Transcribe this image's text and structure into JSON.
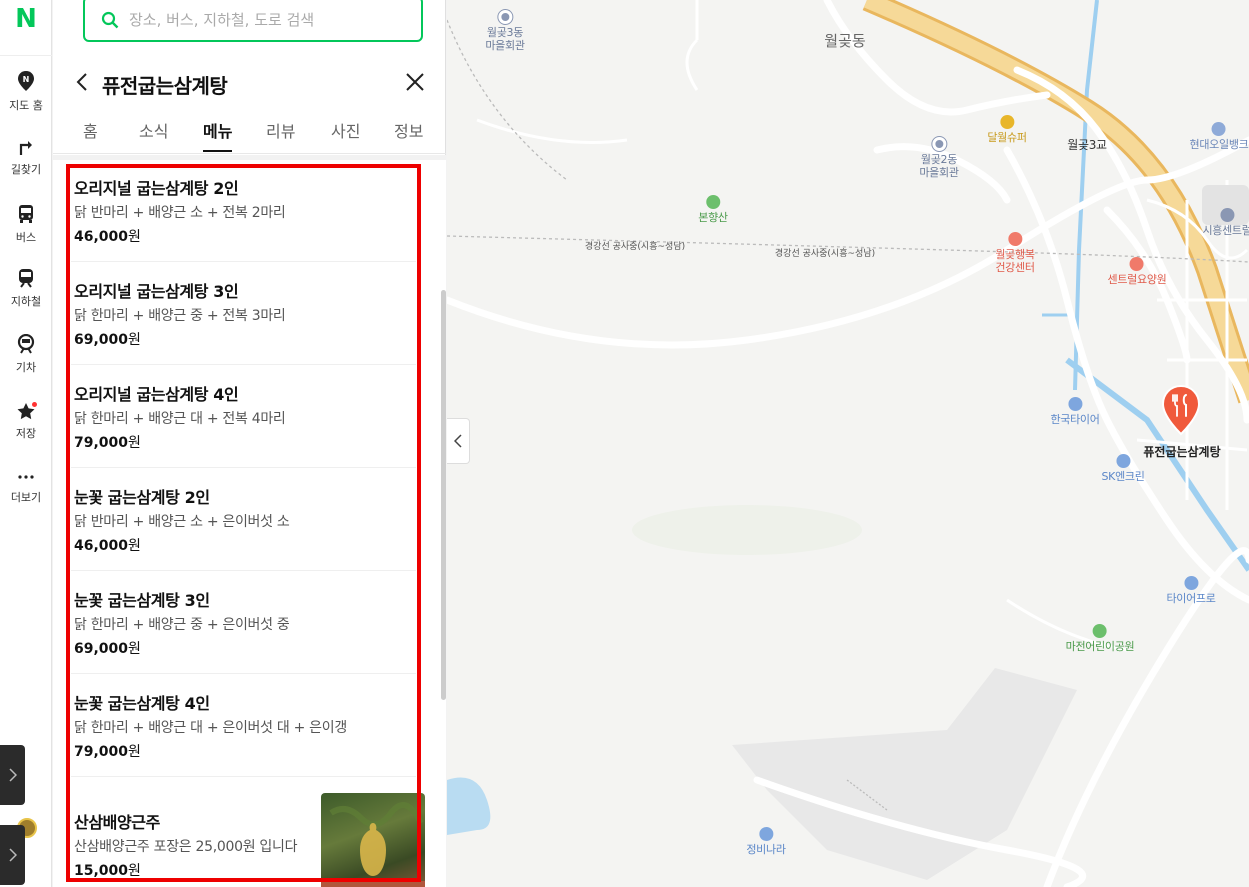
{
  "rail": {
    "logo": "N",
    "items": [
      {
        "label": "지도 홈",
        "icon": "map-home-icon"
      },
      {
        "label": "길찾기",
        "icon": "directions-icon"
      },
      {
        "label": "버스",
        "icon": "bus-icon"
      },
      {
        "label": "지하철",
        "icon": "subway-icon"
      },
      {
        "label": "기차",
        "icon": "train-icon"
      },
      {
        "label": "저장",
        "icon": "star-icon"
      },
      {
        "label": "더보기",
        "icon": "more-icon"
      }
    ]
  },
  "search": {
    "placeholder": "장소, 버스, 지하철, 도로 검색"
  },
  "place": {
    "title": "퓨전굽는삼계탕"
  },
  "tabs": [
    {
      "label": "홈",
      "active": false
    },
    {
      "label": "소식",
      "active": false
    },
    {
      "label": "메뉴",
      "active": true
    },
    {
      "label": "리뷰",
      "active": false
    },
    {
      "label": "사진",
      "active": false
    },
    {
      "label": "정보",
      "active": false
    }
  ],
  "menu": [
    {
      "name": "오리지널 굽는삼계탕 2인",
      "desc": "닭 반마리 + 배양근 소 + 전복 2마리",
      "price": "46,000",
      "unit": "원"
    },
    {
      "name": "오리지널 굽는삼계탕 3인",
      "desc": "닭 한마리 + 배양근 중 + 전복 3마리",
      "price": "69,000",
      "unit": "원"
    },
    {
      "name": "오리지널 굽는삼계탕 4인",
      "desc": "닭 한마리 + 배양근 대 + 전복 4마리",
      "price": "79,000",
      "unit": "원"
    },
    {
      "name": "눈꽃 굽는삼계탕 2인",
      "desc": "닭 반마리 + 배양근 소 + 은이버섯 소",
      "price": "46,000",
      "unit": "원"
    },
    {
      "name": "눈꽃 굽는삼계탕 3인",
      "desc": "닭 한마리 + 배양근 중 + 은이버섯 중",
      "price": "69,000",
      "unit": "원"
    },
    {
      "name": "눈꽃 굽는삼계탕 4인",
      "desc": "닭 한마리 + 배양근 대 + 은이버섯 대 + 은이갱",
      "price": "79,000",
      "unit": "원"
    },
    {
      "name": "산삼배양근주",
      "desc": "산삼배양근주 포장은 25,000원 입니다",
      "price": "15,000",
      "unit": "원"
    }
  ],
  "map": {
    "area_labels": [
      {
        "text": "월곶동"
      }
    ],
    "pois": [
      {
        "text": "월곶3동\n마을회관",
        "color": "#6a7a99"
      },
      {
        "text": "달월슈퍼",
        "color": "#c89a1c"
      },
      {
        "text": "월곶3교",
        "color": "#333333"
      },
      {
        "text": "현대오일뱅크",
        "color": "#6a86b8"
      },
      {
        "text": "월곶2동\n마을회관",
        "color": "#6a7a99"
      },
      {
        "text": "본향산",
        "color": "#4a9a4a"
      },
      {
        "text": "시흥센트럴",
        "color": "#6a7a99"
      },
      {
        "text": "월곶행복\n건강센터",
        "color": "#e05a4a"
      },
      {
        "text": "센트럴요양원",
        "color": "#e05a4a"
      },
      {
        "text": "한국타이어",
        "color": "#5a86c8"
      },
      {
        "text": "SK엔크린",
        "color": "#5a86c8"
      },
      {
        "text": "타이어프로",
        "color": "#5a86c8"
      },
      {
        "text": "마전어린이공원",
        "color": "#4a9a4a"
      },
      {
        "text": "정비나라",
        "color": "#5a86c8"
      }
    ],
    "rail_labels": [
      "경강선 공사중(시흥~성남)",
      "경강선 공사중(시흥~성남)"
    ],
    "selected_place": "퓨전굽는삼계탕",
    "accent": "#f05a3c"
  }
}
